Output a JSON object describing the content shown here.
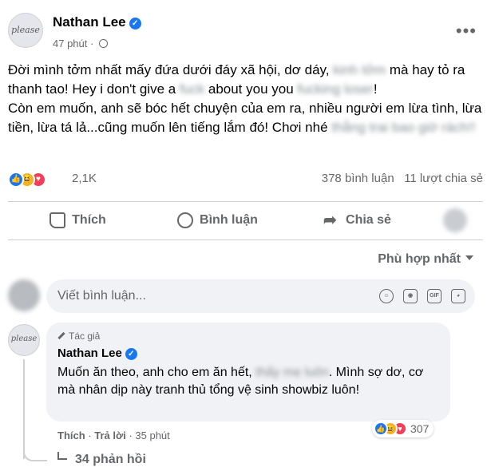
{
  "post": {
    "author": "Nathan Lee",
    "time": "47 phút",
    "avatar_text": "please",
    "content": {
      "p1_a": "Đời mình tởm nhất mấy đứa dưới đáy xã hội, dơ dáy, ",
      "p1_blur1": "kinh tởm",
      "p1_b": " mà hay tỏ ra thanh tao! Hey i don't give a ",
      "p1_blur2": "fuck",
      "p1_c": " about you you ",
      "p1_blur3": "fucking loser",
      "p1_d": "!",
      "p2_a": "Còn em muốn, anh sẽ bóc hết chuyện của em ra, nhiều người em lừa tình, lừa tiền, lừa tá lả...cũng muốn lên tiếng lắm đó! Chơi nhé ",
      "p2_blur": "thằng trai bao giờ rách!!"
    },
    "reaction_count": "2,1K",
    "comment_count": "378 bình luận",
    "share_count": "11 lượt chia sẻ"
  },
  "actions": {
    "like": "Thích",
    "comment": "Bình luận",
    "share": "Chia sẻ"
  },
  "sort_label": "Phù hợp nhất",
  "comment_input_placeholder": "Viết bình luận...",
  "comment": {
    "author_tag": "Tác giả",
    "author": "Nathan Lee",
    "text_a": "Muốn ăn theo, anh cho em ăn hết, ",
    "text_blur": "thấy mẹ luôn",
    "text_b": ". Mình sợ dơ, cơ mà nhân dịp này tranh thủ tổng vệ sinh showbiz luôn!",
    "like": "Thích",
    "reply": "Trả lời",
    "time": "35 phút",
    "reaction_count": "307",
    "replies": "34 phản hồi"
  },
  "colors": {
    "accent": "#1877f2",
    "muted": "#65676b",
    "bubble": "#f0f2f5",
    "love": "#f33e58",
    "haha": "#f7b125"
  }
}
